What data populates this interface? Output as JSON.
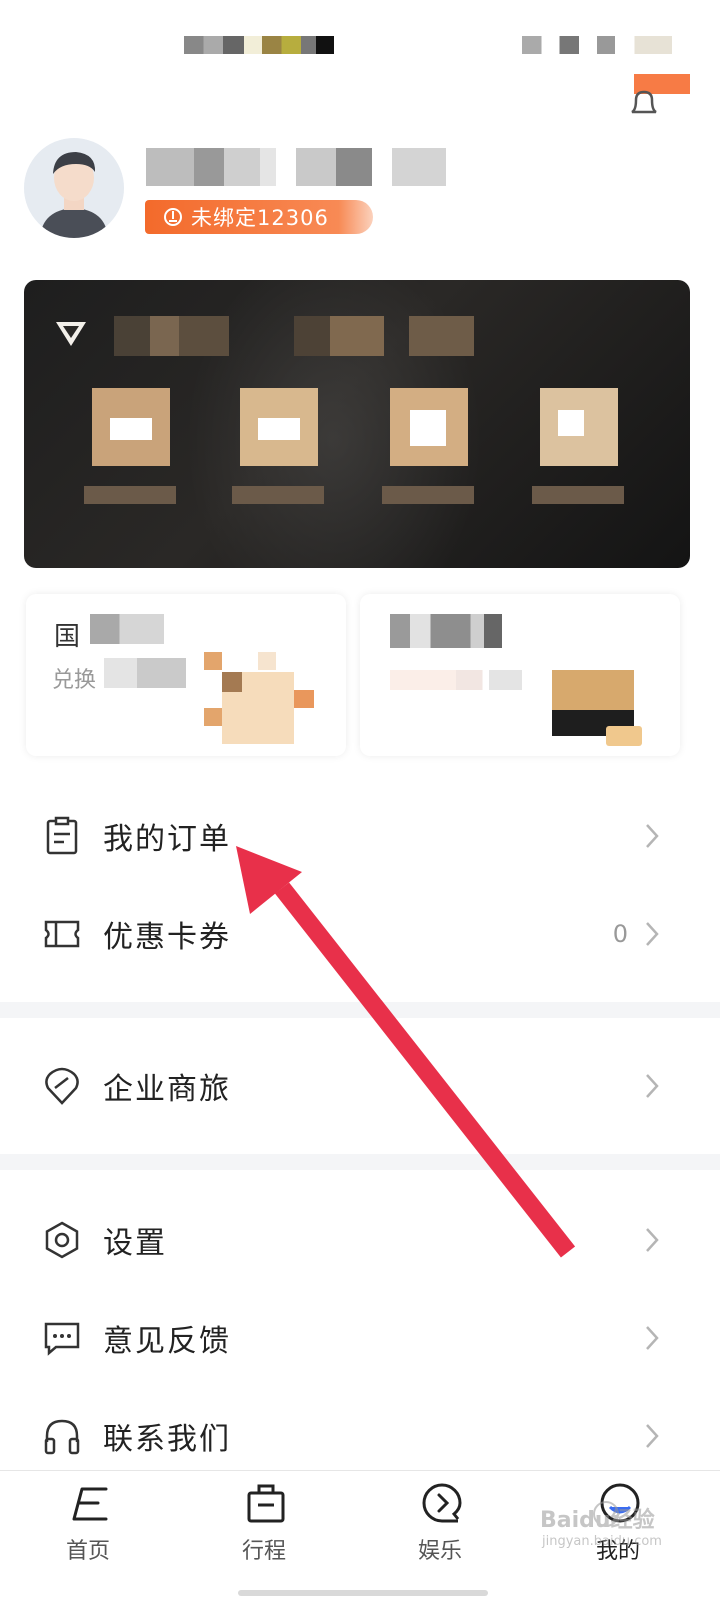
{
  "profile": {
    "bind_badge": "未绑定12306"
  },
  "promo_cards": {
    "left_title": "国",
    "left_subtitle": "兑换"
  },
  "menu": {
    "orders": {
      "label": "我的订单"
    },
    "coupons": {
      "label": "优惠卡券",
      "count": "0"
    },
    "business_travel": {
      "label": "企业商旅"
    },
    "settings": {
      "label": "设置"
    },
    "feedback": {
      "label": "意见反馈"
    },
    "contact": {
      "label": "联系我们"
    }
  },
  "tab_bar": {
    "home": "首页",
    "trips": "行程",
    "entertainment": "娱乐",
    "mine": "我的"
  },
  "watermark": {
    "text": "Baidu经验",
    "url": "jingyan.baidu.com"
  },
  "colors": {
    "accent_orange": "#f36a2b",
    "annotation_arrow": "#e8304a",
    "member_gold": "#c9a37a"
  }
}
